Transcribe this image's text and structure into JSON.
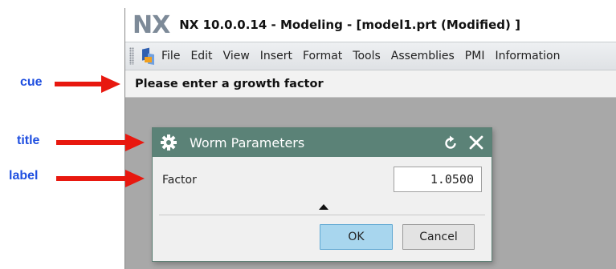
{
  "window": {
    "logo": "NX",
    "title": "NX 10.0.0.14 - Modeling - [model1.prt (Modified) ]",
    "menu": [
      "File",
      "Edit",
      "View",
      "Insert",
      "Format",
      "Tools",
      "Assemblies",
      "PMI",
      "Information"
    ]
  },
  "cue": {
    "text": "Please enter a growth factor"
  },
  "dialog": {
    "title": "Worm Parameters",
    "factor_label": "Factor",
    "factor_value": "1.0500",
    "ok_label": "OK",
    "cancel_label": "Cancel"
  },
  "annotations": {
    "cue": "cue",
    "title": "title",
    "label": "label",
    "color": "#1f4fe0",
    "arrow_color": "#e8180f"
  },
  "colors": {
    "dialog_title_bg": "#5b8277",
    "ok_button_bg": "#a8d6ee",
    "workspace_bg": "#a8a8a8"
  }
}
